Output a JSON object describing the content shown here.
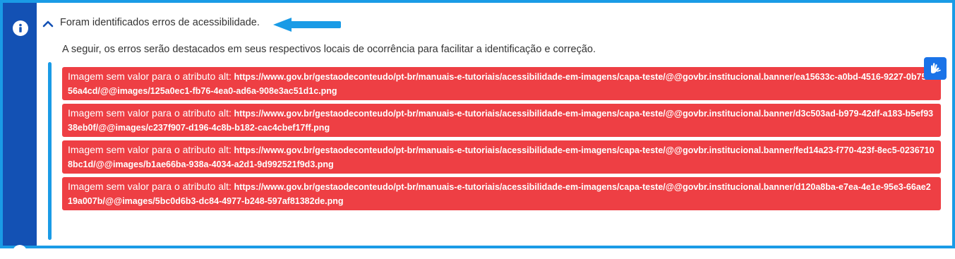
{
  "panel": {
    "title": "Foram identificados erros de acessibilidade.",
    "description": "A seguir, os erros serão destacados em seus respectivos locais de ocorrência para facilitar a identificação e correção.",
    "icon": "info-icon",
    "toggle_icon": "chevron-up-icon",
    "accessibility_widget_icon": "sign-language-hands-icon"
  },
  "errors": [
    {
      "label": "Imagem sem valor para o atributo alt:",
      "url": "https://www.gov.br/gestaodeconteudo/pt-br/manuais-e-tutoriais/acessibilidade-em-imagens/capa-teste/@@govbr.institucional.banner/ea15633c-a0bd-4516-9227-0b75af56a4cd/@@images/125a0ec1-fb76-4ea0-ad6a-908e3ac51d1c.png"
    },
    {
      "label": "Imagem sem valor para o atributo alt:",
      "url": "https://www.gov.br/gestaodeconteudo/pt-br/manuais-e-tutoriais/acessibilidade-em-imagens/capa-teste/@@govbr.institucional.banner/d3c503ad-b979-42df-a183-b5ef9338eb0f/@@images/c237f907-d196-4c8b-b182-cac4cbef17ff.png"
    },
    {
      "label": "Imagem sem valor para o atributo alt:",
      "url": "https://www.gov.br/gestaodeconteudo/pt-br/manuais-e-tutoriais/acessibilidade-em-imagens/capa-teste/@@govbr.institucional.banner/fed14a23-f770-423f-8ec5-02367108bc1d/@@images/b1ae66ba-938a-4034-a2d1-9d992521f9d3.png"
    },
    {
      "label": "Imagem sem valor para o atributo alt:",
      "url": "https://www.gov.br/gestaodeconteudo/pt-br/manuais-e-tutoriais/acessibilidade-em-imagens/capa-teste/@@govbr.institucional.banner/d120a8ba-e7ea-4e1e-95e3-66ae219a007b/@@images/5bc0d6b3-dc84-4977-b248-597af81382de.png"
    }
  ],
  "colors": {
    "frame_border": "#1a9be6",
    "left_strip": "#1351b4",
    "error_background": "#ee3f44",
    "annotation_arrow": "#1a9be6",
    "vlibras_button": "#1a73e8"
  }
}
